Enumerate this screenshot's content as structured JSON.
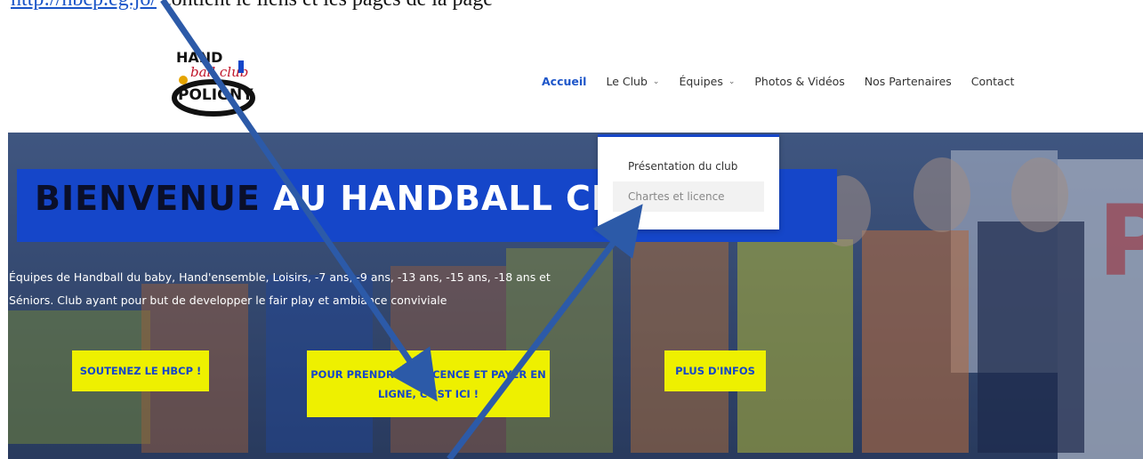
{
  "top_note": {
    "link_text": "http://hbcp.eg.jo/",
    "text": "contient le liens et les pages de la page"
  },
  "logo": {
    "text_lines": [
      "HAND",
      "ball club",
      "POLIGNY"
    ]
  },
  "nav": {
    "items": [
      {
        "label": "Accueil",
        "active": true,
        "has_dropdown": false
      },
      {
        "label": "Le Club",
        "active": false,
        "has_dropdown": true
      },
      {
        "label": "Équipes",
        "active": false,
        "has_dropdown": true
      },
      {
        "label": "Photos & Vidéos",
        "active": false,
        "has_dropdown": false
      },
      {
        "label": "Nos Partenaires",
        "active": false,
        "has_dropdown": false
      },
      {
        "label": "Contact",
        "active": false,
        "has_dropdown": false
      }
    ],
    "active_color": "#1e56c9"
  },
  "dropdown": {
    "items": [
      "Présentation du club",
      "Chartes et licence"
    ],
    "hovered_index": 1
  },
  "hero": {
    "title_dark": "BIENVENUE",
    "title_light": "AU HANDBALL CLUB DE",
    "description": "Équipes de Handball du baby, Hand'ensemble, Loisirs, -7 ans, -9 ans, -13 ans, -15 ans, -18 ans et Séniors. Club ayant pour but de developper le fair play et ambiance conviviale",
    "band_color": "#1546c9",
    "buttons": [
      {
        "label": "SOUTENEZ LE HBCP !"
      },
      {
        "label": "POUR PRENDRE TA LICENCE ET PAYER EN LIGNE, C'EST ICI !"
      },
      {
        "label": "PLUS D'INFOS"
      }
    ],
    "button_color": "#eef000"
  },
  "annotation": {
    "arrow_color": "#2c5aa8"
  }
}
